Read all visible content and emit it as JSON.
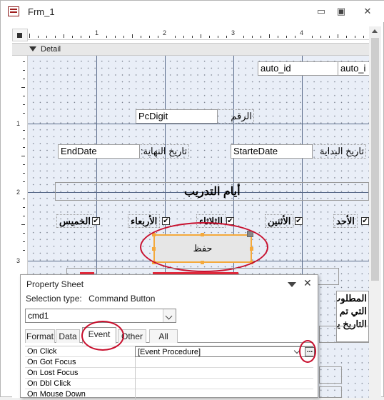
{
  "window": {
    "title": "Frm_1",
    "minimize": "▭",
    "restore": "▣",
    "close": "✕"
  },
  "ruler": {
    "top_numbers": [
      "1",
      "2",
      "3",
      "4"
    ],
    "left_numbers": [
      "1",
      "2",
      "3"
    ]
  },
  "section": {
    "name": "Detail"
  },
  "form": {
    "auto_id_text": "auto_id",
    "auto_id_label": "auto_i",
    "pcdigit_text": "PcDigit",
    "pcdigit_label": "الرقم",
    "enddate_text": "EndDate",
    "enddate_label": "تاريخ النهاية:",
    "startdate_text": "StarteDate",
    "startdate_label": "تاريخ البداية",
    "heading": "أيام التدريب",
    "days": [
      {
        "label": "الخميس",
        "checked": "✔"
      },
      {
        "label": "الأربعاء",
        "checked": "✔"
      },
      {
        "label": "الثلاثاء",
        "checked": "✔"
      },
      {
        "label": "الأثنين",
        "checked": "✔"
      },
      {
        "label": "الأحد",
        "checked": "✔"
      }
    ],
    "save_button": "حفظ",
    "right_text_lines": [
      "المطلوب عن",
      "التي تم تح",
      "التاريخ يلي"
    ]
  },
  "property_sheet": {
    "title": "Property Sheet",
    "selection_type_label": "Selection type:",
    "selection_type_value": "Command Button",
    "selected_object": "cmd1",
    "close": "✕",
    "tabs": [
      "Format",
      "Data",
      "Event",
      "Other",
      "All"
    ],
    "active_tab": "Event",
    "properties": [
      {
        "name": "On Click",
        "value": "[Event Procedure]"
      },
      {
        "name": "On Got Focus",
        "value": ""
      },
      {
        "name": "On Lost Focus",
        "value": ""
      },
      {
        "name": "On Dbl Click",
        "value": ""
      },
      {
        "name": "On Mouse Down",
        "value": ""
      }
    ],
    "builder_button": "..."
  },
  "colors": {
    "highlight_ellipse": "#c8102e",
    "selection_handle": "#f4a93c",
    "grid": "#e9eef7"
  }
}
